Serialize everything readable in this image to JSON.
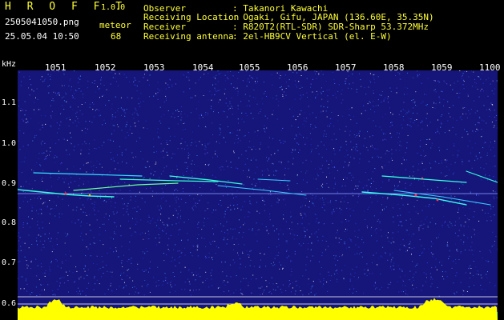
{
  "app": {
    "title": "H R O F F T",
    "version": "1.0.0"
  },
  "file": {
    "name": "2505041050.png",
    "datetime": "25.05.04 10:50"
  },
  "counter": {
    "label": "meteor",
    "value": "68"
  },
  "info": [
    {
      "label": "Observer",
      "value": ": Takanori Kawachi"
    },
    {
      "label": "Receiving Location",
      "value": ": Ogaki, Gifu, JAPAN (136.60E, 35.35N)"
    },
    {
      "label": "Receiver",
      "value": ": R820T2(RTL-SDR) SDR-Sharp 53.372MHz"
    },
    {
      "label": "Receiving antenna",
      "value": ": 2el-HB9CV Vertical (el. E-W)"
    }
  ],
  "axis": {
    "unit": "kHz",
    "y_ticks": [
      "1.1",
      "1.0",
      "0.9",
      "0.8",
      "0.7",
      "0.6"
    ],
    "time_ticks": [
      "1051",
      "1052",
      "1053",
      "1054",
      "1055",
      "1056",
      "1057",
      "1058",
      "1059",
      "1100"
    ]
  },
  "colors": {
    "background": "#000000",
    "noise": "#1a1a8c",
    "text_accent": "#ffff33",
    "level": "#ffff00",
    "level_base": "#00e5ff"
  }
}
